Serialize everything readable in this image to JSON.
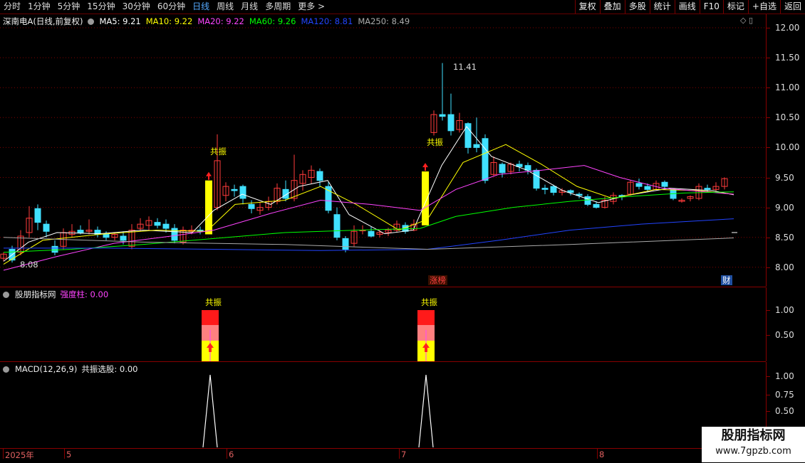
{
  "toolbar": {
    "periods": [
      "分时",
      "1分钟",
      "5分钟",
      "15分钟",
      "30分钟",
      "60分钟",
      "日线",
      "周线",
      "月线",
      "多周期",
      "更多 >"
    ],
    "active_index": 6,
    "right_buttons": [
      "复权",
      "叠加",
      "多股",
      "统计",
      "画线",
      "F10",
      "标记",
      "+自选",
      "返回"
    ]
  },
  "main_pane": {
    "title": "深南电A(日线,前复权)",
    "ma_labels": [
      {
        "text": "MA5: 9.21",
        "color": "#ffffff"
      },
      {
        "text": "MA10: 9.22",
        "color": "#ffff00"
      },
      {
        "text": "MA20: 9.22",
        "color": "#ff44ff"
      },
      {
        "text": "MA60: 9.26",
        "color": "#00ff00"
      },
      {
        "text": "MA120: 8.81",
        "color": "#2244ff"
      },
      {
        "text": "MA250: 8.49",
        "color": "#aaaaaa"
      }
    ],
    "axis_labels": [
      "12.00",
      "11.50",
      "11.00",
      "10.50",
      "10.00",
      "9.50",
      "9.00",
      "8.50",
      "8.00"
    ],
    "high_label": "11.41",
    "low_label": "8.08",
    "signal_text": "共振",
    "tag_zhangbang": "涨榜",
    "tag_cai": "财"
  },
  "pane2": {
    "title": "股朋指标网",
    "value_label": "强度柱: 0.00",
    "axis_labels": [
      "1.00",
      "0.50"
    ],
    "top_text": "共振"
  },
  "pane3": {
    "title": "MACD(12,26,9)",
    "value_label": "共振选股: 0.00",
    "axis_labels": [
      "1.00",
      "0.75",
      "0.50"
    ]
  },
  "xaxis": {
    "labels": [
      "2025年",
      "5",
      "6",
      "7",
      "8"
    ]
  },
  "watermark": {
    "line1": "股朋指标网",
    "line2": "www.7gpzb.com"
  },
  "colors": {
    "up": "#ff3b3b",
    "down": "#40e0ff",
    "grid": "#800000",
    "signal": "#ffff00"
  }
}
